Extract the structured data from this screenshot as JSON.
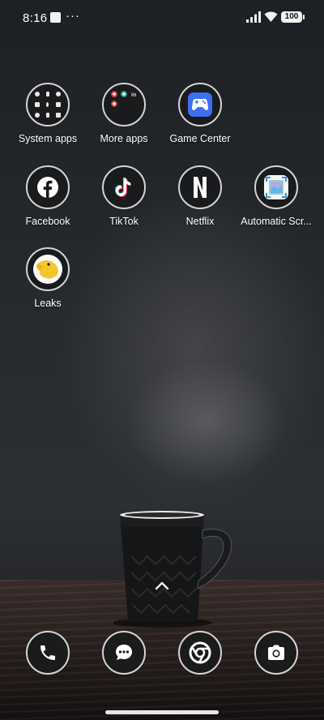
{
  "status_bar": {
    "time": "8:16",
    "dots": "···",
    "battery": "100"
  },
  "apps": [
    {
      "id": "system-apps",
      "label": "System apps"
    },
    {
      "id": "more-apps",
      "label": "More apps"
    },
    {
      "id": "game-center",
      "label": "Game Center"
    },
    {
      "id": "facebook",
      "label": "Facebook"
    },
    {
      "id": "tiktok",
      "label": "TikTok"
    },
    {
      "id": "netflix",
      "label": "Netflix"
    },
    {
      "id": "automatic-scr",
      "label": "Automatic Scr..."
    },
    {
      "id": "leaks",
      "label": "Leaks"
    }
  ],
  "dock": [
    {
      "icon": "phone-icon"
    },
    {
      "icon": "messages-icon"
    },
    {
      "icon": "chrome-icon"
    },
    {
      "icon": "camera-icon"
    }
  ],
  "colors": {
    "icon_ring": "#d5d5d5",
    "game_center": "#3d6ff0",
    "leaks_yellow": "#f4c62e"
  }
}
